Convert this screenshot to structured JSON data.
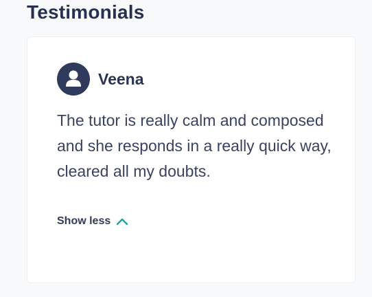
{
  "section": {
    "title": "Testimonials"
  },
  "testimonial": {
    "author": "Veena",
    "avatar_icon": "user-avatar-icon",
    "text": "The tutor is really calm and composed and she responds in a really quick way, cleared all my doubts.",
    "toggle_label": "Show less",
    "toggle_icon": "chevron-up-icon"
  },
  "colors": {
    "title": "#27304f",
    "avatar_bg": "#2f3a5c",
    "chevron": "#1aa39a",
    "card_bg": "#ffffff",
    "page_bg": "#f8f9fb"
  }
}
